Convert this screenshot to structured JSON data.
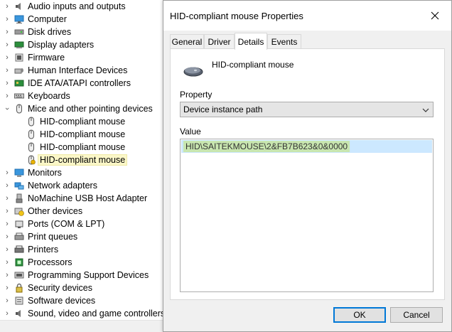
{
  "tree": {
    "items": [
      {
        "label": "Audio inputs and outputs",
        "icon": "speaker-icon",
        "expanded": false
      },
      {
        "label": "Computer",
        "icon": "computer-icon",
        "expanded": false
      },
      {
        "label": "Disk drives",
        "icon": "disk-drive-icon",
        "expanded": false
      },
      {
        "label": "Display adapters",
        "icon": "display-adapter-icon",
        "expanded": false
      },
      {
        "label": "Firmware",
        "icon": "firmware-icon",
        "expanded": false
      },
      {
        "label": "Human Interface Devices",
        "icon": "hid-icon",
        "expanded": false
      },
      {
        "label": "IDE ATA/ATAPI controllers",
        "icon": "ide-controller-icon",
        "expanded": false
      },
      {
        "label": "Keyboards",
        "icon": "keyboard-icon",
        "expanded": false
      },
      {
        "label": "Mice and other pointing devices",
        "icon": "mouse-icon",
        "expanded": true
      },
      {
        "label": "HID-compliant mouse",
        "icon": "mouse-icon",
        "child": true
      },
      {
        "label": "HID-compliant mouse",
        "icon": "mouse-icon",
        "child": true
      },
      {
        "label": "HID-compliant mouse",
        "icon": "mouse-icon",
        "child": true
      },
      {
        "label": "HID-compliant mouse",
        "icon": "mouse-warning-icon",
        "child": true,
        "selected": true
      },
      {
        "label": "Monitors",
        "icon": "monitor-icon",
        "expanded": false
      },
      {
        "label": "Network adapters",
        "icon": "network-adapter-icon",
        "expanded": false
      },
      {
        "label": "NoMachine USB Host Adapter",
        "icon": "usb-adapter-icon",
        "expanded": false
      },
      {
        "label": "Other devices",
        "icon": "unknown-device-icon",
        "expanded": false
      },
      {
        "label": "Ports (COM & LPT)",
        "icon": "port-icon",
        "expanded": false
      },
      {
        "label": "Print queues",
        "icon": "print-queue-icon",
        "expanded": false
      },
      {
        "label": "Printers",
        "icon": "printer-icon",
        "expanded": false
      },
      {
        "label": "Processors",
        "icon": "processor-icon",
        "expanded": false
      },
      {
        "label": "Programming Support Devices",
        "icon": "programming-device-icon",
        "expanded": false
      },
      {
        "label": "Security devices",
        "icon": "security-device-icon",
        "expanded": false
      },
      {
        "label": "Software devices",
        "icon": "software-device-icon",
        "expanded": false
      },
      {
        "label": "Sound, video and game controllers",
        "icon": "sound-controller-icon",
        "expanded": false
      }
    ]
  },
  "dialog": {
    "title": "HID-compliant mouse Properties",
    "tabs": [
      {
        "label": "General",
        "active": false
      },
      {
        "label": "Driver",
        "active": false
      },
      {
        "label": "Details",
        "active": true
      },
      {
        "label": "Events",
        "active": false
      }
    ],
    "device_name": "HID-compliant mouse",
    "property_label": "Property",
    "property_value": "Device instance path",
    "value_label": "Value",
    "value_text": "HID\\SAITEKMOUSE\\2&FB7B623&0&0000",
    "ok_label": "OK",
    "cancel_label": "Cancel"
  },
  "colors": {
    "selection_blue": "#cce8ff",
    "highlight_green": "#c8e6b0",
    "tree_selected": "#fbf7c8",
    "default_button_border": "#0078d7"
  }
}
